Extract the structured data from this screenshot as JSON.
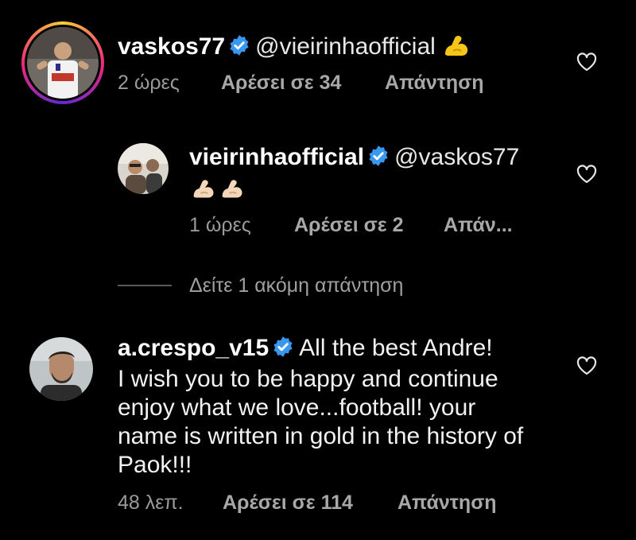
{
  "comments": [
    {
      "username": "vaskos77",
      "mention": "@vieirinhaofficial",
      "text": "",
      "emoji": "flexed-biceps",
      "time": "2 ώρες",
      "likes": "Αρέσει σε 34",
      "reply": "Απάντηση"
    },
    {
      "username": "vieirinhaofficial",
      "mention": "@vaskos77",
      "text": "",
      "emoji": "flexed-biceps-x2",
      "time": "1 ώρες",
      "likes": "Αρέσει σε 2",
      "reply": "Απάν..."
    },
    {
      "username": "a.crespo_v15",
      "mention": "",
      "text_lines": [
        "All the best Andre!",
        "I wish you to be happy and continue",
        "enjoy what we love...football! your",
        "name is written in gold in the history of",
        "Paok!!!"
      ],
      "time": "48 λεπ.",
      "likes": "Αρέσει σε 114",
      "reply": "Απάντηση"
    }
  ],
  "view_more_replies": "Δείτε 1 ακόμη απάντηση",
  "colors": {
    "background": "#000000",
    "verified": "#3897f0",
    "meta_text": "#9a9a9a",
    "emoji_yellow": "#f5c518"
  },
  "icons": [
    "verified-badge-icon",
    "heart-icon",
    "flexed-biceps-emoji"
  ]
}
